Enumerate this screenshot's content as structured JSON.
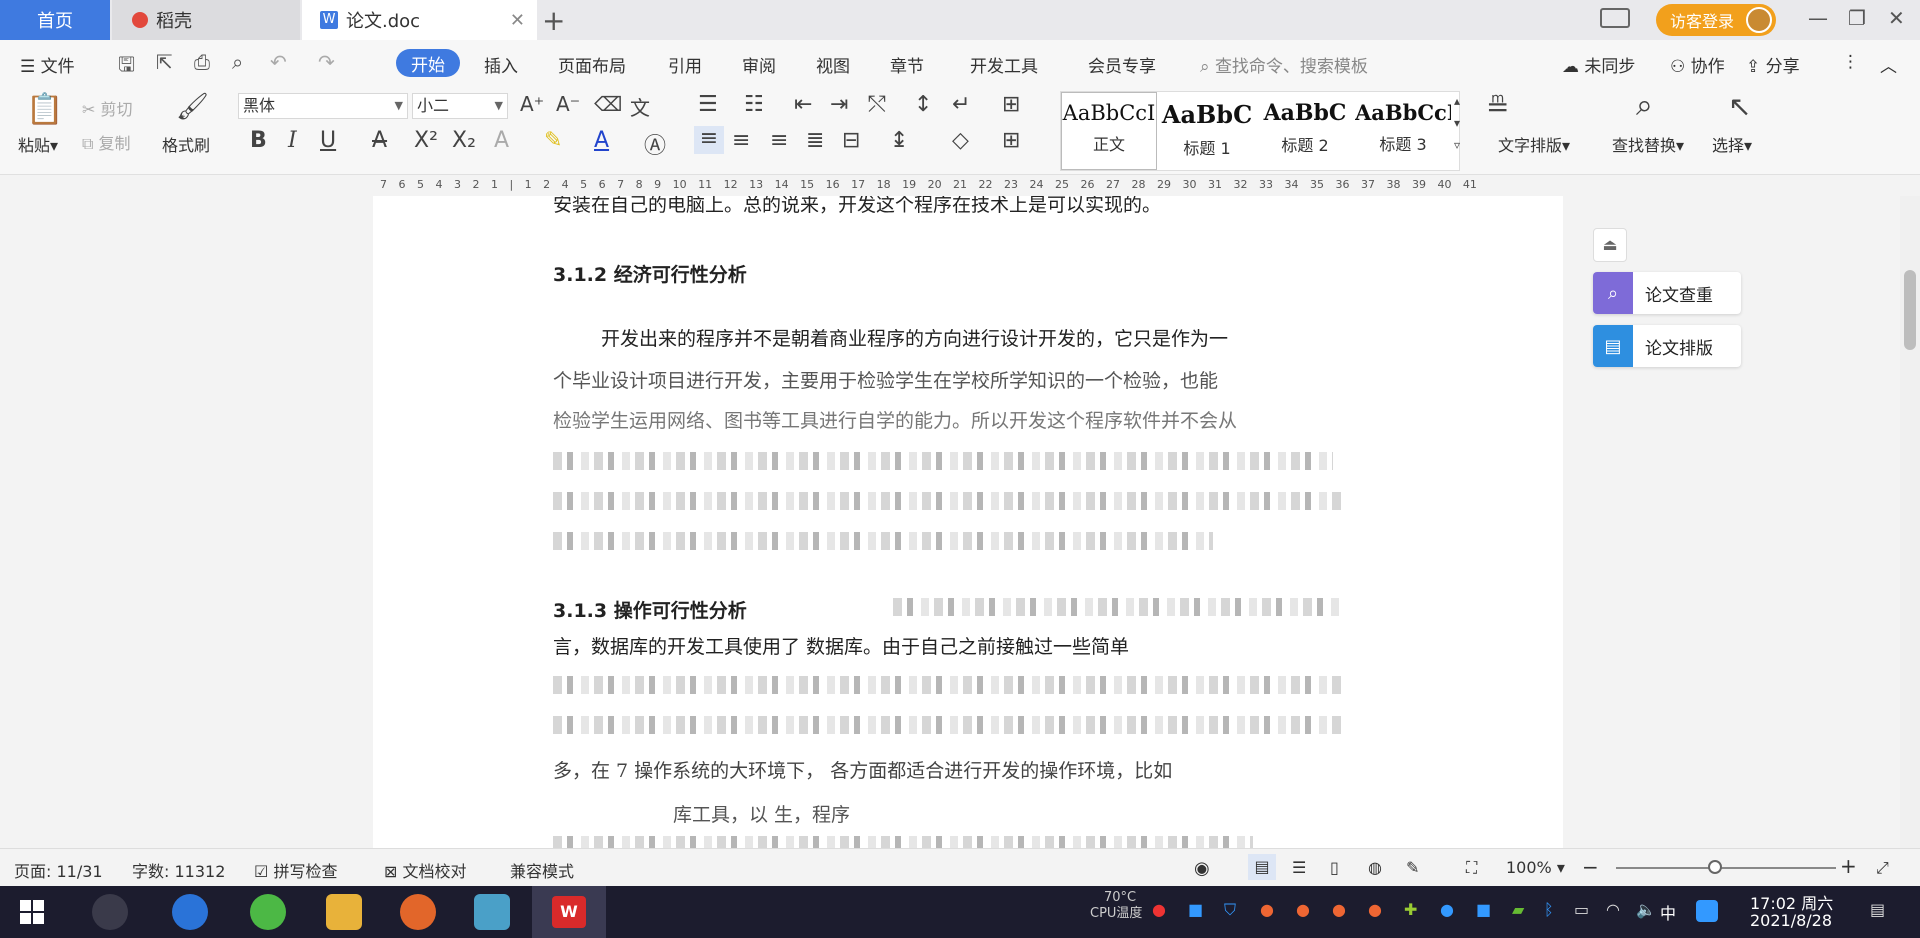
{
  "tabs": {
    "home": "首页",
    "daoke": "稻壳",
    "doc": "论文.doc",
    "visitor_login": "访客登录"
  },
  "menu": {
    "file": "文件",
    "start": "开始",
    "insert": "插入",
    "page_layout": "页面布局",
    "reference": "引用",
    "review": "审阅",
    "view": "视图",
    "chapter": "章节",
    "developer": "开发工具",
    "member": "会员专享",
    "search_placeholder": "查找命令、搜索模板",
    "unsynced": "未同步",
    "collab": "协作",
    "share": "分享"
  },
  "toolbar": {
    "paste": "粘贴",
    "cut": "剪切",
    "copy": "复制",
    "format_painter": "格式刷",
    "font_name": "黑体",
    "font_size": "小二",
    "styles": [
      {
        "preview": "AaBbCcI",
        "name": "正文"
      },
      {
        "preview": "AaBbC",
        "name": "标题 1"
      },
      {
        "preview": "AaBbC",
        "name": "标题 2"
      },
      {
        "preview": "AaBbCcI",
        "name": "标题 3"
      }
    ],
    "text_layout": "文字排版",
    "find_replace": "查找替换",
    "select": "选择"
  },
  "ruler": "7 6 5 4 3 2 1 | 1 2 4 5 6 7 8 9 10 11 12 13 14 15 16 17 18 19 20 21 22 23 24 25 26 27 28 29 30 31 32 33 34 35 36 37 38 39 40 41",
  "document": {
    "top_line": "安装在自己的电脑上。总的说来，开发这个程序在技术上是可以实现的。",
    "heading_312": "3.1.2  经济可行性分析",
    "para_1": "开发出来的程序并不是朝着商业程序的方向进行设计开发的，它只是作为一",
    "para_2": "个毕业设计项目进行开发，主要用于检验学生在学校所学知识的一个检验，也能",
    "para_3": "检验学生运用网络、图书等工具进行自学的能力。所以开发这个程序软件并不会从",
    "heading_313": "3.1.3  操作可行性分析",
    "para_4": "言，数据库的开发工具使用了                数据库。由于自己之前接触过一些简单",
    "para_5": "多，在        7 操作系统的大环境下，     各方面都适合进行开发的操作环境，比如",
    "para_6": "库工具，以     生，程序"
  },
  "side_panel": {
    "check": "论文查重",
    "layout": "论文排版"
  },
  "status": {
    "page": "页面: 11/31",
    "words": "字数: 11312",
    "spell": "拼写检查",
    "proof": "文档校对",
    "compat": "兼容模式",
    "zoom": "100%"
  },
  "taskbar": {
    "temp": "70°C",
    "cpu": "CPU温度",
    "ime": "中",
    "time": "17:02 周六",
    "date": "2021/8/28"
  }
}
